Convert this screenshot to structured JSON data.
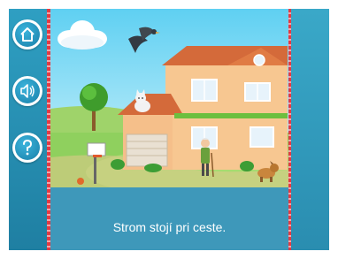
{
  "sidebar": {
    "buttons": [
      {
        "name": "home",
        "icon": "home-icon"
      },
      {
        "name": "sound",
        "icon": "speaker-icon"
      },
      {
        "name": "help",
        "icon": "question-mark-icon"
      }
    ]
  },
  "scene": {
    "elements": [
      "cloud",
      "crow",
      "house",
      "tree",
      "cat",
      "grandpa",
      "dog",
      "basketball-hoop",
      "ball"
    ]
  },
  "caption": {
    "text": "Strom stojí pri ceste."
  },
  "colors": {
    "sidebar": "#2f9fc2",
    "stripe": "#e23b44",
    "caption_panel": "#3e98ba",
    "caption_text": "#ffffff"
  }
}
